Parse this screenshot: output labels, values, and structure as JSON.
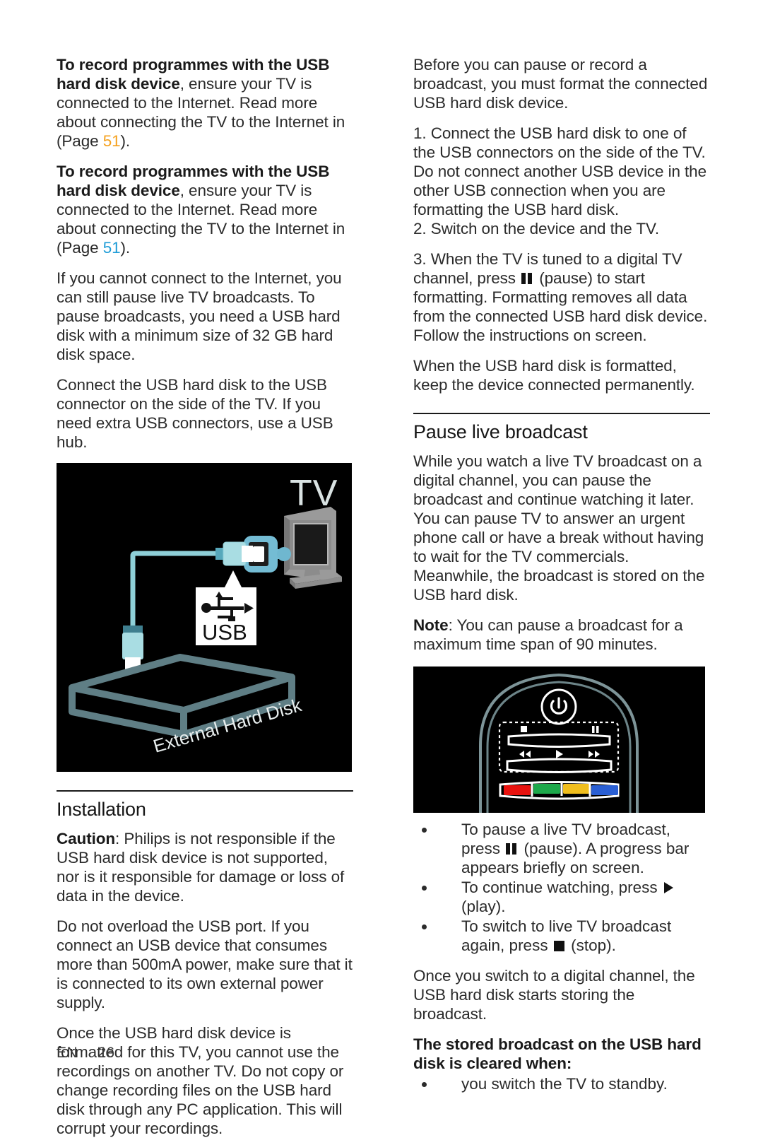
{
  "document": {
    "language_code": "EN",
    "page_number": "26"
  },
  "colors": {
    "link_orange": "#f5a11e",
    "link_blue": "#1e9cd7",
    "remote_red": "#e8120e",
    "remote_green": "#1da84a",
    "remote_yellow": "#f0be1e",
    "remote_blue": "#2a5fd4",
    "figure_background": "#000000",
    "cable_teal": "#8fd0d8",
    "connector_blue": "#6fb7cf",
    "tv_gray": "#8c8c8c",
    "harddisk_slate": "#5f7e85"
  },
  "left_column": {
    "para_1": {
      "bold_lead": "To record programmes with the USB hard disk device",
      "rest_before_link": ", ensure your TV is connected to the Internet. Read more about connecting the TV to the Internet in  (Page ",
      "page_link": "51",
      "rest_after_link": ")."
    },
    "para_2": {
      "bold_lead": "To record programmes with the USB hard disk device",
      "rest_before_link": ", ensure your TV is connected to the Internet. Read more about connecting the TV to the Internet in  (Page ",
      "page_link": "51",
      "rest_after_link": ")."
    },
    "para_3": "If you cannot connect to the Internet, you can still pause live TV broadcasts. To pause broadcasts, you need a USB hard disk with a minimum size of 32 GB hard disk space.",
    "para_4": "Connect the USB hard disk to the USB connector on the side of the TV. If you need extra USB connectors, use a USB hub.",
    "figure": {
      "name": "usb-hard-disk-connection-diagram",
      "tv_label": "TV",
      "usb_label": "USB",
      "harddisk_label": "External Hard Disk"
    },
    "installation": {
      "heading": "Installation",
      "para_1_bold": "Caution",
      "para_1_rest": ": Philips is not responsible if the USB hard disk device is not supported, nor is it responsible for damage or loss of data in the device.",
      "para_2": "Do not overload the USB port. If you connect an USB device that consumes more than 500mA power, make sure that it is connected to its own external power supply.",
      "para_3": "Once the USB hard disk device is formatted for this TV, you cannot use the recordings on another TV. Do not copy or change recording files on the USB hard disk through any PC application. This will corrupt your recordings."
    }
  },
  "right_column": {
    "para_1": "Before you can pause or record a broadcast, you must format the connected USB hard disk device.",
    "step_1": "1. Connect the USB hard disk to one of the USB connectors on the side of the TV. Do not connect another USB device in the other USB connection when you are formatting the USB hard disk.",
    "step_2": "2. Switch on the device and the TV.",
    "step_3_before_icon": "3. When the TV is tuned to a digital TV channel, press ",
    "step_3_icon": "pause-icon",
    "step_3_after_icon": " (pause) to start formatting. Formatting removes all data from the connected USB hard disk device. Follow the instructions on screen.",
    "para_2": "When the USB hard disk is formatted, keep the device connected permanently.",
    "pause_section": {
      "heading": "Pause live broadcast",
      "para_1": "While you watch a live TV broadcast on a digital channel, you can pause the broadcast and continue watching it later. You can pause TV to answer an urgent phone call or have a break without having to wait for the TV commercials. Meanwhile, the broadcast is stored on the USB hard disk.",
      "note_bold": "Note",
      "note_rest": ": You can pause a broadcast for a maximum time span of 90 minutes."
    },
    "figure": {
      "name": "remote-control-playback-buttons-diagram",
      "buttons": [
        "power-icon",
        "stop-icon",
        "pause-icon",
        "rewind-icon",
        "play-icon",
        "fast-forward-icon"
      ],
      "colour_keys": [
        "red",
        "green",
        "yellow",
        "blue"
      ]
    },
    "bullets": [
      {
        "before_icon": "To pause a live TV broadcast, press ",
        "icon": "pause-icon",
        "after_icon": " (pause). A progress bar appears briefly on screen."
      },
      {
        "before_icon": "To continue watching, press ",
        "icon": "play-icon",
        "after_icon": " (play)."
      },
      {
        "before_icon": "To switch to live TV broadcast again, press ",
        "icon": "stop-icon",
        "after_icon": " (stop)."
      }
    ],
    "para_3": "Once you switch to a digital channel, the USB hard disk starts storing the broadcast.",
    "cleared_heading": "The stored broadcast on the USB hard disk is cleared when:",
    "cleared_bullets": [
      "you switch the TV to standby."
    ]
  }
}
